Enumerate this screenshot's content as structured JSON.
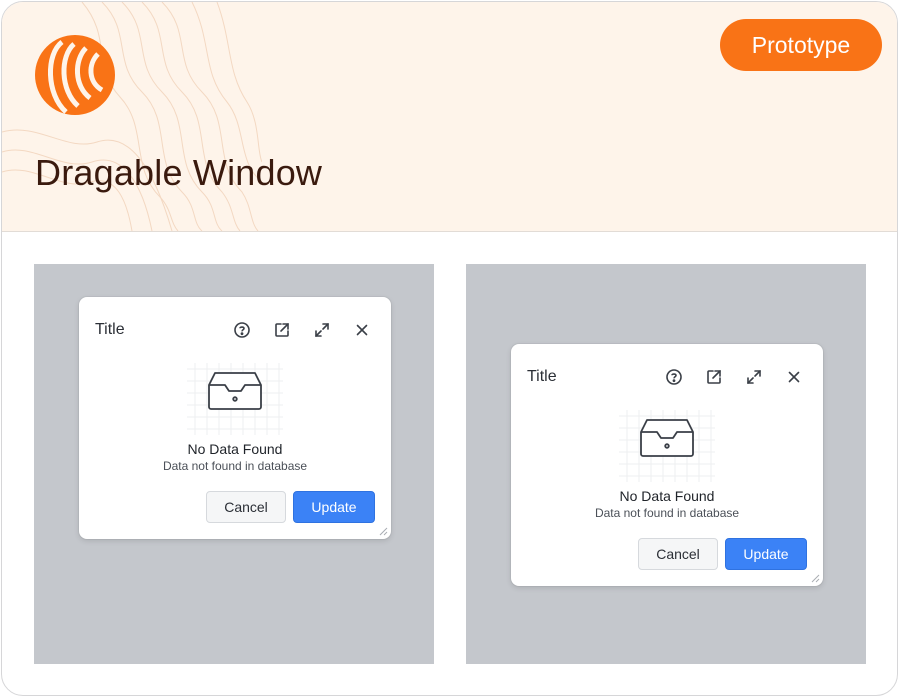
{
  "header": {
    "title": "Dragable Window",
    "badge": "Prototype"
  },
  "windows": [
    {
      "title": "Title",
      "empty_title": "No Data Found",
      "empty_subtitle": "Data not found in database",
      "cancel_label": "Cancel",
      "update_label": "Update"
    },
    {
      "title": "Title",
      "empty_title": "No Data Found",
      "empty_subtitle": "Data not found in database",
      "cancel_label": "Cancel",
      "update_label": "Update"
    }
  ],
  "icons": [
    "help-icon",
    "open-external-icon",
    "expand-icon",
    "close-icon",
    "empty-inbox-icon",
    "resize-grip-icon"
  ],
  "colors": {
    "accent": "#f97316",
    "header_bg": "#fef4ea",
    "title_text": "#3a1a0e",
    "panel_bg": "#c4c7cc",
    "primary_button": "#3b82f6"
  }
}
